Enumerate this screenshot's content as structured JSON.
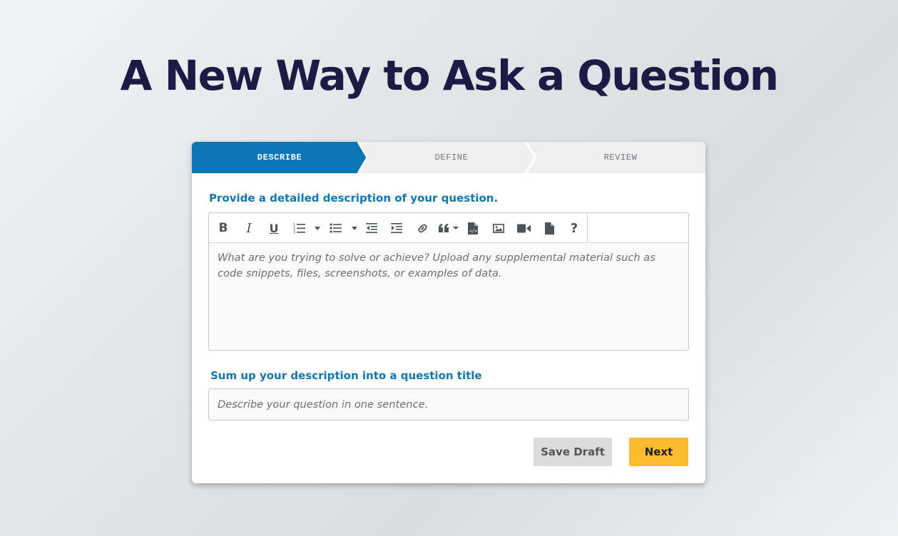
{
  "page": {
    "title": "A New Way to Ask a Question"
  },
  "steps": [
    {
      "label": "DESCRIBE",
      "active": true
    },
    {
      "label": "DEFINE",
      "active": false
    },
    {
      "label": "REVIEW",
      "active": false
    }
  ],
  "description": {
    "label": "Provide a detailed description of your question.",
    "placeholder": "What are you trying to solve or achieve? Upload any supplemental material such as code snippets, files, screenshots, or examples of data."
  },
  "toolbar": {
    "buttons": [
      "bold-icon",
      "italic-icon",
      "underline-icon",
      "ordered-list-icon",
      "ordered-list-dropdown-icon",
      "unordered-list-icon",
      "unordered-list-dropdown-icon",
      "outdent-icon",
      "indent-icon",
      "link-icon",
      "blockquote-icon",
      "code-file-icon",
      "image-icon",
      "video-icon",
      "file-icon",
      "help-icon"
    ]
  },
  "title_field": {
    "label": "Sum up your description into a question title",
    "placeholder": "Describe your question in one sentence.",
    "value": ""
  },
  "actions": {
    "save_draft": "Save Draft",
    "next": "Next"
  },
  "colors": {
    "heading": "#1c1b45",
    "step_active": "#0b75b6",
    "step_inactive": "#efefef",
    "label": "#1177b3",
    "next_button": "#fdbb2f",
    "draft_button": "#dcdcdc"
  }
}
